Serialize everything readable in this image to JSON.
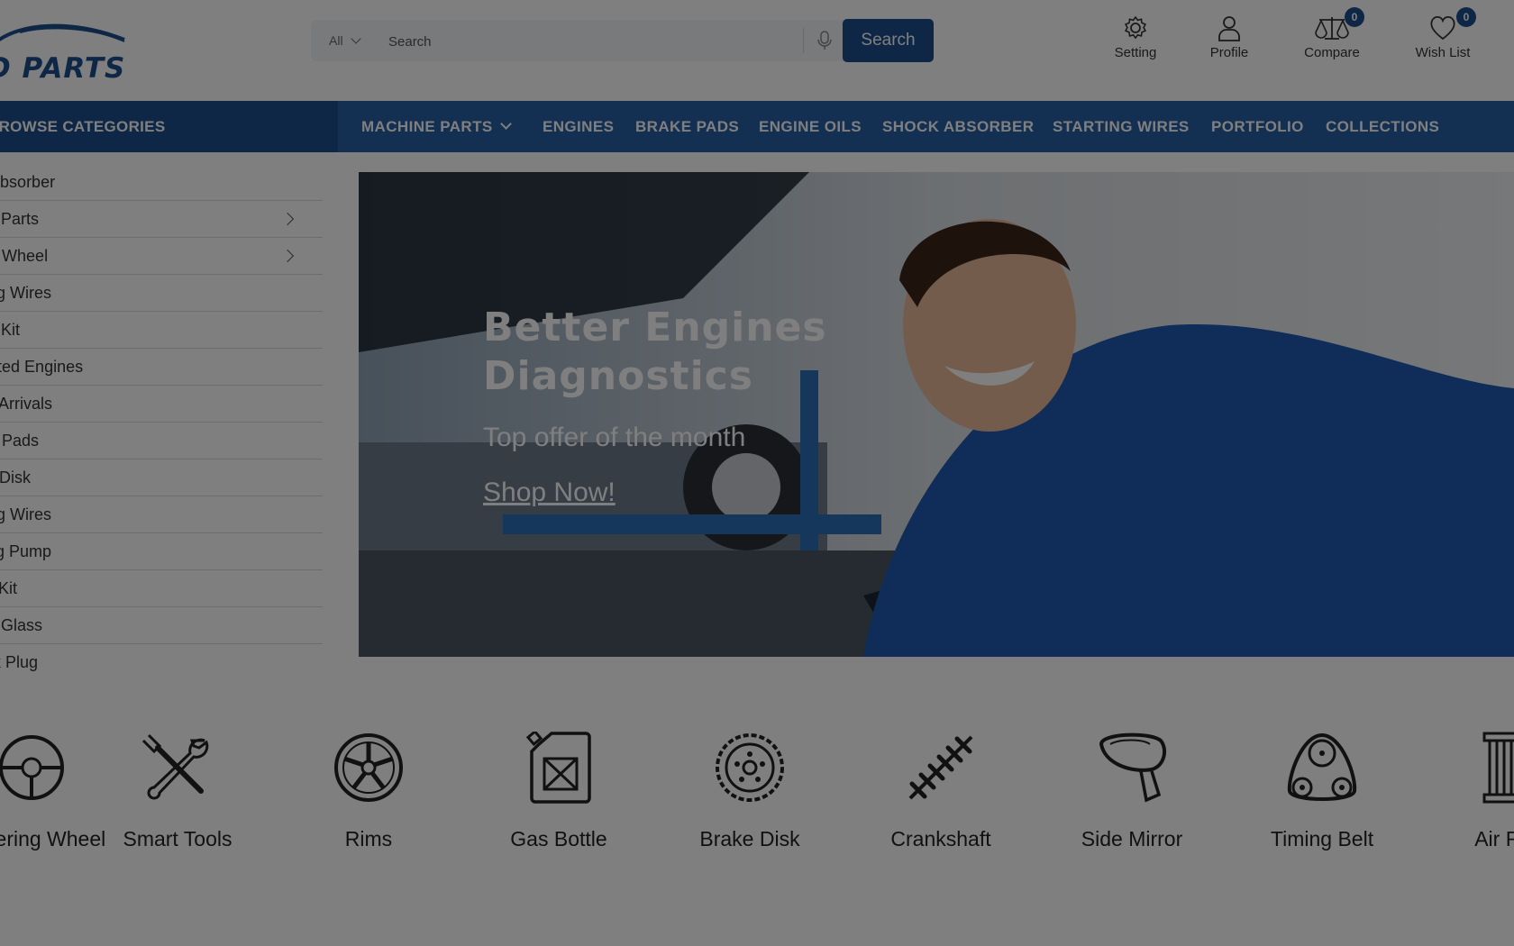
{
  "header": {
    "logo_text": "D PARTS",
    "search": {
      "category": "All",
      "placeholder": "Search",
      "button_label": "Search"
    },
    "icons": [
      {
        "label": "Setting",
        "icon": "gear-icon"
      },
      {
        "label": "Profile",
        "icon": "user-icon"
      },
      {
        "label": "Compare",
        "icon": "scale-icon",
        "badge": "0"
      },
      {
        "label": "Wish List",
        "icon": "heart-icon",
        "badge": "0"
      }
    ]
  },
  "nav": {
    "browse_label": "BROWSE CATEGORIES",
    "links": [
      "MACHINE PARTS",
      "ENGINES",
      "BRAKE PADS",
      "ENGINE OILS",
      "SHOCK ABSORBER",
      "STARTING WIRES",
      "PORTFOLIO",
      "COLLECTIONS"
    ]
  },
  "sidebar": {
    "items": [
      {
        "label": "Shock Absorber"
      },
      {
        "label": "Machine Parts"
      },
      {
        "label": "Steering Wheel"
      },
      {
        "label": "Starting Wires"
      },
      {
        "label": "Tools Kit"
      },
      {
        "label": "Rebuilted Engines"
      },
      {
        "label": "New Arrivals"
      },
      {
        "label": "Brake Pads"
      },
      {
        "label": "Brake Disk"
      },
      {
        "label": "Starting Wires"
      },
      {
        "label": "Cooling Pump"
      },
      {
        "label": "Tools Kit"
      },
      {
        "label": "Wind Glass"
      },
      {
        "label": "Spark Plug"
      }
    ]
  },
  "banner": {
    "title_line1": "Better Engines",
    "title_line2": "Diagnostics",
    "subtitle": "Top offer of the month",
    "link": "Shop Now!"
  },
  "categories": [
    {
      "name": "Steering Wheel",
      "icon": "steering-wheel-icon"
    },
    {
      "name": "Smart Tools",
      "icon": "tools-icon"
    },
    {
      "name": "Rims",
      "icon": "rim-icon"
    },
    {
      "name": "Gas Bottle",
      "icon": "gas-can-icon"
    },
    {
      "name": "Brake Disk",
      "icon": "brake-disk-icon"
    },
    {
      "name": "Crankshaft",
      "icon": "crankshaft-icon"
    },
    {
      "name": "Side Mirror",
      "icon": "side-mirror-icon"
    },
    {
      "name": "Timing Belt",
      "icon": "timing-belt-icon"
    },
    {
      "name": "Air Filter",
      "icon": "air-filter-icon"
    }
  ],
  "colors": {
    "brand": "#1e4f8c",
    "nav": "#275ea5",
    "overlay": "rgba(0,0,0,0.5)"
  }
}
